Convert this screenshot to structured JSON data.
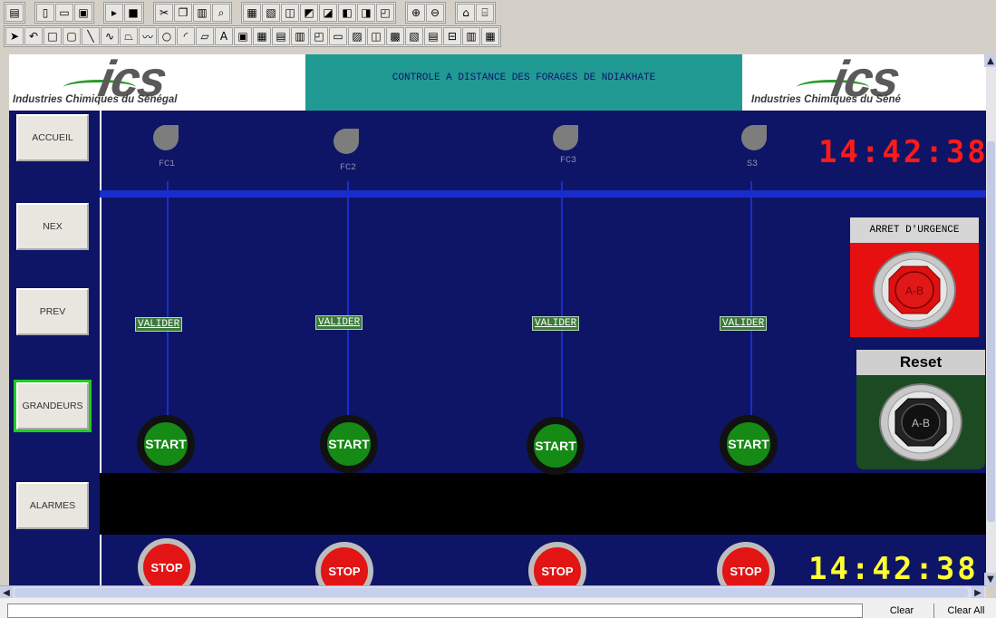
{
  "toolbar_top": {
    "groups": [
      [
        "doc-icon"
      ],
      [
        "new-icon",
        "open-icon",
        "save-icon"
      ],
      [
        "run-icon",
        "stop-square-icon"
      ],
      [
        "cut-icon",
        "copy-icon",
        "paste-icon",
        "find-icon"
      ],
      [
        "grid-a-icon",
        "grid-b-icon",
        "tool-a-icon",
        "tool-b-icon",
        "tool-c-icon",
        "tool-d-icon",
        "tool-e-icon",
        "tool-f-icon"
      ],
      [
        "zoom-in-icon",
        "zoom-out-icon"
      ],
      [
        "frame-a-icon",
        "frame-b-icon"
      ]
    ]
  },
  "toolbar_draw": {
    "glyphs": [
      "➤",
      "↶",
      "□",
      "▢",
      "╲",
      "∿",
      "⏢",
      "〰",
      "○",
      "◜",
      "▱",
      "A",
      "▣",
      "▦",
      "▤",
      "▥",
      "◰",
      "▭",
      "▨",
      "◫",
      "▩",
      "▧",
      "▤",
      "⊟",
      "▥",
      "▦"
    ]
  },
  "header": {
    "logo_text": "ics",
    "logo_subtitle": "Industries Chimiques du Sénégal",
    "logo_subtitle_right": "Industries Chimiques du Séné",
    "title": "CONTROLE A DISTANCE DES FORAGES DE NDIAKHATE"
  },
  "nav": {
    "items": [
      {
        "label": "ACCUEIL"
      },
      {
        "label": "NEX"
      },
      {
        "label": "PREV"
      },
      {
        "label": "GRANDEURS"
      },
      {
        "label": "ALARMES"
      }
    ]
  },
  "pumps": [
    {
      "label": "FC1",
      "valider": "VALIDER",
      "start": "START",
      "stop": "STOP"
    },
    {
      "label": "FC2",
      "valider": "VALIDER",
      "start": "START",
      "stop": "STOP"
    },
    {
      "label": "FC3",
      "valider": "VALIDER",
      "start": "START",
      "stop": "STOP"
    },
    {
      "label": "S3",
      "valider": "VALIDER",
      "start": "START",
      "stop": "STOP"
    }
  ],
  "clock_top": "14:42:38",
  "clock_bottom": "14:42:38",
  "emergency": {
    "label": "ARRET D'URGENCE",
    "button_text": "A-B"
  },
  "reset": {
    "label": "Reset",
    "button_text": "A-B"
  },
  "status_bar": {
    "clear": "Clear",
    "clear_all": "Clear All"
  },
  "colors": {
    "background": "#0e1566",
    "pipe": "#1a2dcc",
    "clock_top": "#ff1a1a",
    "clock_bottom": "#ffff33",
    "title_bar": "#219a94"
  }
}
